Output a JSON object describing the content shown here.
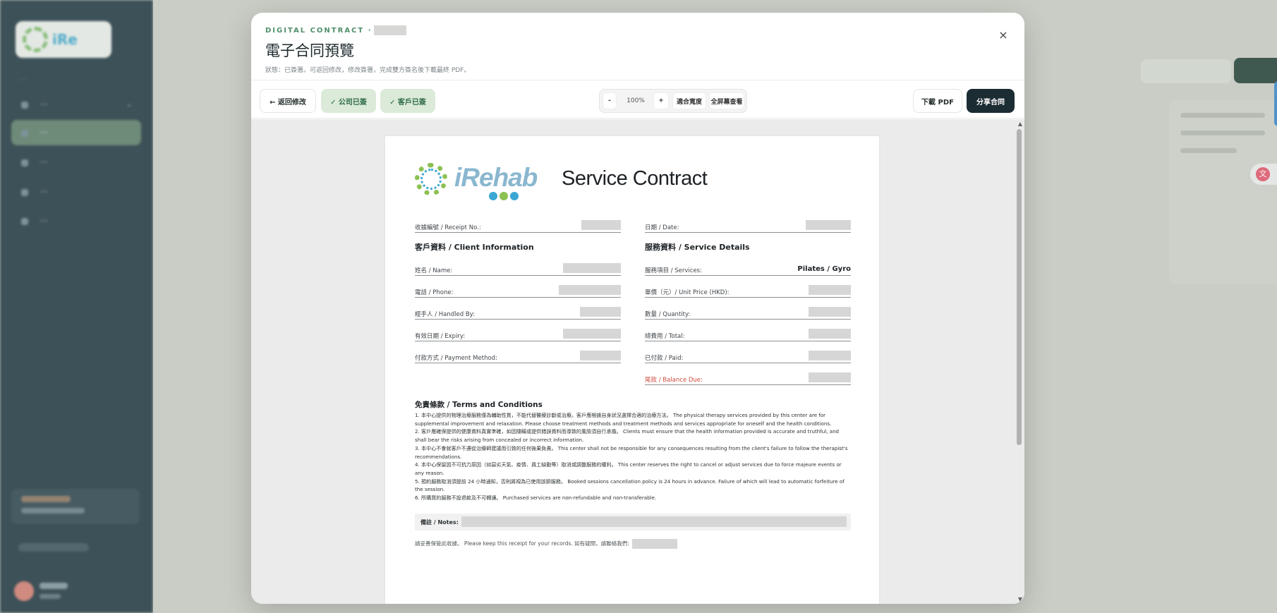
{
  "modal": {
    "eyebrow": "DIGITAL CONTRACT ·",
    "title": "電子合同預覽",
    "status": "狀態：已簽署。可返回修改，修改簽署，完成雙方簽名後下載最終 PDF。",
    "close_label": "×"
  },
  "toolbar": {
    "back_label": "← 返回修改",
    "company_signed_label": "✓ 公司已簽",
    "client_signed_label": "✓ 客戶已簽",
    "zoom_out_label": "-",
    "zoom_level": "100%",
    "zoom_in_label": "+",
    "fit_width_label": "適合寬度",
    "full_view_label": "全屏幕查看",
    "download_label": "下載 PDF",
    "share_label": "分享合同"
  },
  "contract": {
    "logo_text": "iRehab",
    "title": "Service Contract",
    "receipt_label": "收據編號 / Receipt No.:",
    "date_label": "日期 / Date:",
    "client_section": "客戶資料 / Client Information",
    "service_section": "服務資料 / Service Details",
    "client_fields": [
      "姓名 / Name:",
      "電話 / Phone:",
      "經手人 / Handled By:",
      "有效日期 / Expiry:",
      "付款方式 / Payment Method:"
    ],
    "service_fields": {
      "services_label": "服務項目 / Services:",
      "services_value": "Pilates / Gyro",
      "unit_price_label": "單價（元）/ Unit Price (HKD):",
      "quantity_label": "數量 / Quantity:",
      "total_label": "總費用 / Total:",
      "paid_label": "已付款 / Paid:",
      "balance_label": "尾款 / Balance Due:"
    },
    "terms_title": "免責條款 / Terms and Conditions",
    "terms": [
      "1. 本中心提供的物理治療服務僅為輔助性質，不能代替醫療診斷或治療。客戶應根據自身狀況選擇合適的治療方法。 The physical therapy services provided by this center are for supplemental improvement and relaxation. Please choose treatment methods and treatment methods and services appropriate for oneself and the health conditions.",
      "2. 客戶應確保提供的健康資料真實準確，如因隱瞞或提供錯誤資料而導致的風險須自行承擔。 Clients must ensure that the health information provided is accurate and truthful, and shall bear the risks arising from concealed or incorrect information.",
      "3. 本中心不會就客戶不遵從治療師建議而引致的任何後果負責。 This center shall not be responsible for any consequences resulting from the client's failure to follow the therapist's recommendations.",
      "4. 本中心保留因不可抗力原因（如惡劣天氣、疫情、員工缺勤等）取消或調整服務的權利。 This center reserves the right to cancel or adjust services due to force majeure events or any reason.",
      "5. 預約服務取消須提前 24 小時通知，否則將視為已使用該節服務。 Booked sessions cancellation policy is 24 hours in advance. Failure of which will lead to automatic forfeiture of the session.",
      "6. 所購買的服務不設退款及不可轉讓。 Purchased services are non-refundable and non-transferable."
    ],
    "notes_label": "備註 / Notes:",
    "footer_text": "請妥善保管此收據。 Please keep this receipt for your records.  如有疑問，請聯絡我們:"
  },
  "colors": {
    "brand_green": "#4f8f6a",
    "share_button": "#1c2c33",
    "signed_badge_bg": "#dbead9",
    "balance_due_red": "#d04a3a"
  },
  "icons": [
    "close-icon",
    "back-arrow-icon",
    "check-icon",
    "irehab-logo",
    "translate-icon"
  ]
}
